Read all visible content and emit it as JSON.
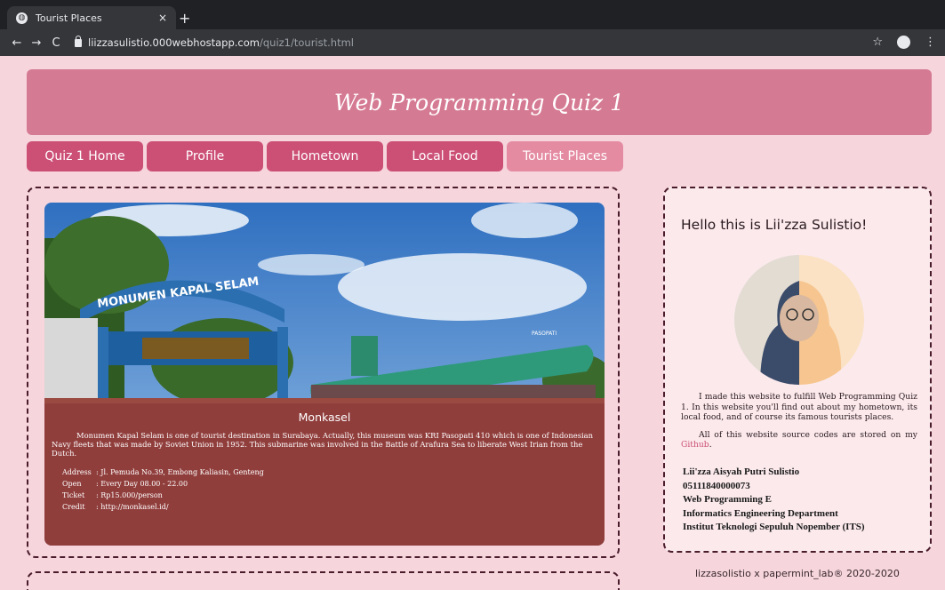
{
  "browser": {
    "tab_title": "Tourist Places",
    "tab_close": "×",
    "new_tab": "+",
    "url_host": "liizzasulistio.000webhostapp.com",
    "url_path": "/quiz1/tourist.html",
    "back": "←",
    "forward": "→",
    "reload": "C",
    "star": "☆",
    "menu": "⋮"
  },
  "header": {
    "title": "Web Programming Quiz 1"
  },
  "nav": [
    {
      "label": "Quiz 1 Home"
    },
    {
      "label": "Profile"
    },
    {
      "label": "Hometown"
    },
    {
      "label": "Local Food"
    },
    {
      "label": "Tourist Places"
    }
  ],
  "place": {
    "sign_text": "MONUMEN KAPAL SELAM",
    "ship_text": "PASOPATI",
    "title": "Monkasel",
    "description": "Monumen Kapal Selam is one of tourist destination in Surabaya. Actually, this museum was KRI Pasopati 410 which is one of Indonesian Navy fleets that was made by Soviet Union in 1952. This submarine was involved in the Battle of Arafura Sea to liberate West Irian from the Dutch.",
    "info": [
      {
        "key": "Address",
        "value": ": Jl. Pemuda No.39, Embong Kaliasin, Genteng"
      },
      {
        "key": "Open",
        "value": ": Every Day 08.00 - 22.00"
      },
      {
        "key": "Ticket",
        "value": ": Rp15.000/person"
      },
      {
        "key": "Credit",
        "value": ": http://monkasel.id/"
      }
    ]
  },
  "profile": {
    "greeting": "Hello this is Lii'zza Sulistio!",
    "about_1": "I made this website to fulfill Web Programming Quiz 1. In this website you'll find out about my hometown, its local food, and of course its famous tourists places.",
    "about_2_prefix": "All of this website source codes are stored on my ",
    "about_2_link": "Github",
    "about_2_suffix": ".",
    "credentials": [
      "Lii'zza Aisyah Putri Sulistio",
      "05111840000073",
      "Web Programming E",
      "Informatics Engineering Department",
      "Institut Teknologi Sepuluh Nopember (ITS)"
    ]
  },
  "footer": {
    "text": "lizzasolistio x papermint_lab® 2020-2020"
  },
  "colors": {
    "page_bg": "#f6d5dc",
    "header_bg": "#d57a93",
    "nav_bg": "#cc4f76",
    "nav_active_bg": "#e48ba2",
    "overlay": "#8c3a3a"
  }
}
